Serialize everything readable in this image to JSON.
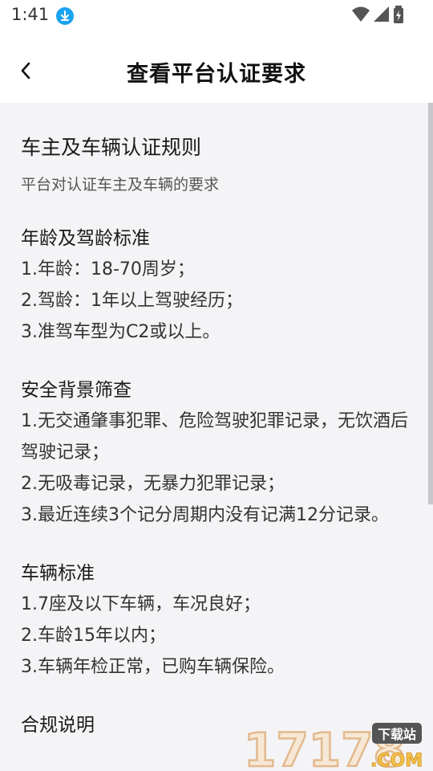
{
  "status_bar": {
    "time": "1:41"
  },
  "header": {
    "title": "查看平台认证要求"
  },
  "document": {
    "title": "车主及车辆认证规则",
    "subtitle": "平台对认证车主及车辆的要求",
    "sections": [
      {
        "title": "年龄及驾龄标准",
        "items": [
          "1.年龄：18-70周岁；",
          "2.驾龄：1年以上驾驶经历；",
          "3.准驾车型为C2或以上。"
        ]
      },
      {
        "title": "安全背景筛查",
        "items": [
          "1.无交通肇事犯罪、危险驾驶犯罪记录，无饮酒后驾驶记录；",
          "2.无吸毒记录，无暴力犯罪记录；",
          "3.最近连续3个记分周期内没有记满12分记录。"
        ]
      },
      {
        "title": "车辆标准",
        "items": [
          "1.7座及以下车辆，车况良好；",
          "2.车龄15年以内；",
          "3.车辆年检正常，已购车辆保险。"
        ]
      },
      {
        "title": "合规说明",
        "items": []
      }
    ]
  },
  "watermark": {
    "number": "17178",
    "badge": "下载站",
    "domain": ".COM"
  },
  "colors": {
    "accent": "#1aa3ee",
    "background": "#f4f4f6"
  }
}
